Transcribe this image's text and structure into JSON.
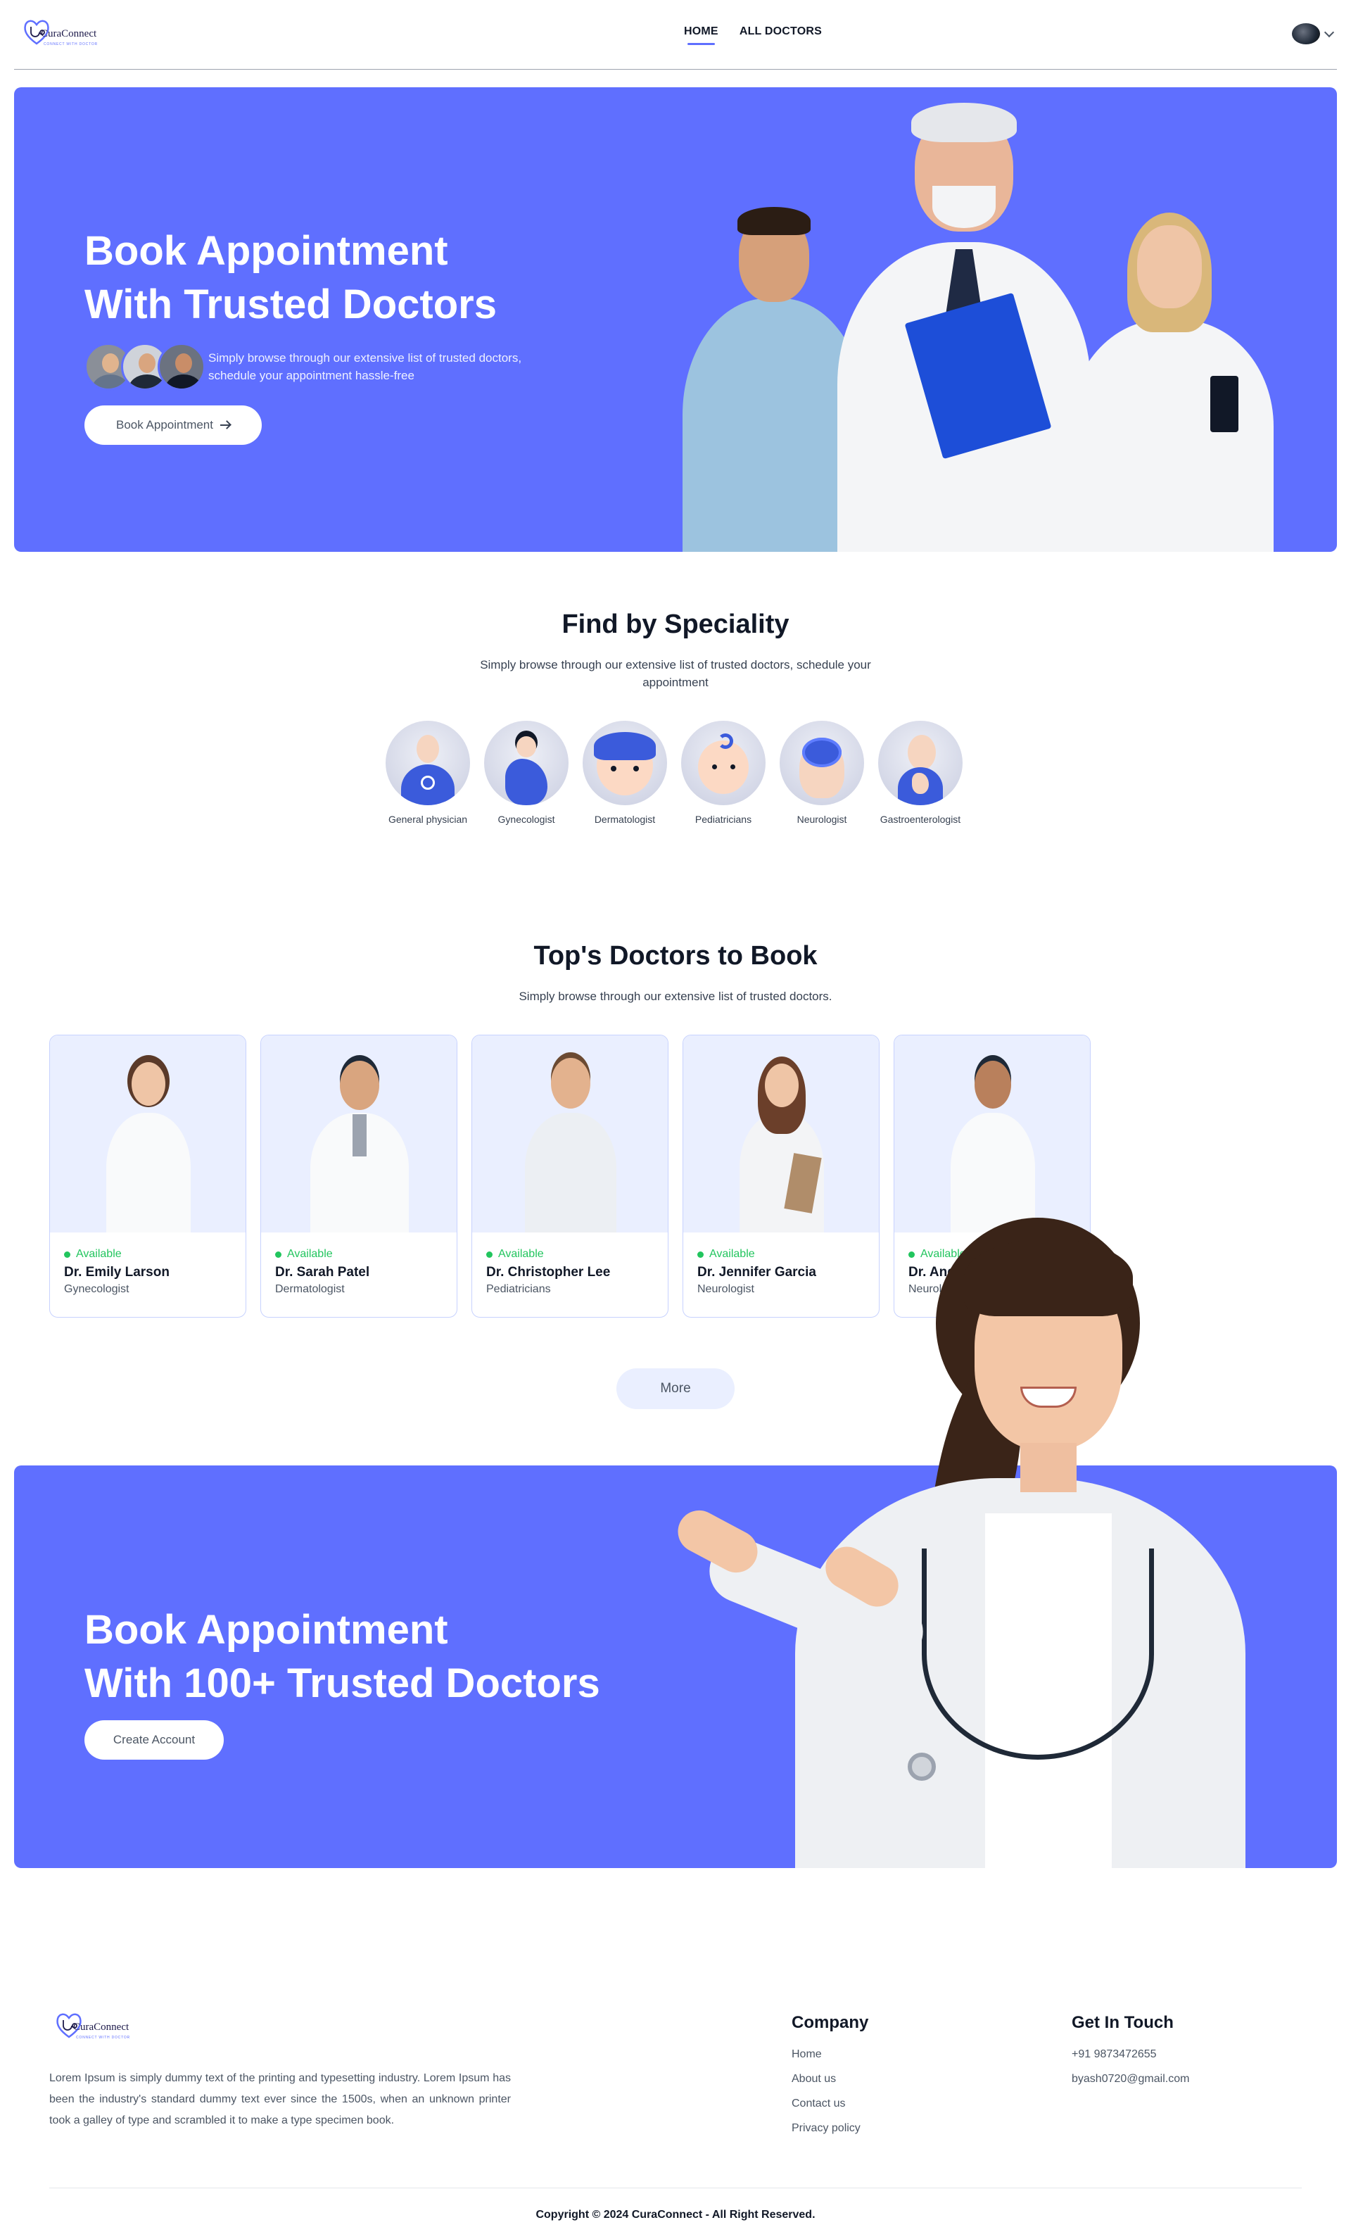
{
  "brand": {
    "name": "CuraConnect",
    "tagline": "CONNECT WITH DOCTOR",
    "accent": "#5f6fff"
  },
  "nav": {
    "links": [
      "HOME",
      "ALL DOCTORS"
    ],
    "active": "HOME"
  },
  "hero": {
    "title_line1": "Book Appointment",
    "title_line2": "With Trusted Doctors",
    "subtitle": "Simply browse through our extensive list of trusted doctors, schedule your appointment hassle-free",
    "button": "Book Appointment"
  },
  "speciality": {
    "title": "Find by Speciality",
    "subtitle": "Simply browse through our extensive list of trusted doctors, schedule your appointment",
    "items": [
      {
        "label": "General physician",
        "icon": "general-physician-icon"
      },
      {
        "label": "Gynecologist",
        "icon": "gynecologist-icon"
      },
      {
        "label": "Dermatologist",
        "icon": "dermatologist-icon"
      },
      {
        "label": "Pediatricians",
        "icon": "pediatrician-icon"
      },
      {
        "label": "Neurologist",
        "icon": "neurologist-icon"
      },
      {
        "label": "Gastroenterologist",
        "icon": "gastroenterologist-icon"
      }
    ]
  },
  "top_doctors": {
    "title": "Top's Doctors to Book",
    "subtitle": "Simply browse through our extensive list of trusted doctors.",
    "doctors": [
      {
        "status": "Available",
        "name": "Dr. Emily Larson",
        "speciality": "Gynecologist"
      },
      {
        "status": "Available",
        "name": "Dr. Sarah Patel",
        "speciality": "Dermatologist"
      },
      {
        "status": "Available",
        "name": "Dr. Christopher Lee",
        "speciality": "Pediatricians"
      },
      {
        "status": "Available",
        "name": "Dr. Jennifer Garcia",
        "speciality": "Neurologist"
      },
      {
        "status": "Available",
        "name": "Dr. Andrew Williams",
        "speciality": "Neurologist"
      }
    ],
    "more_button": "More"
  },
  "banner": {
    "title_line1": "Book Appointment",
    "title_line2": "With 100+ Trusted Doctors",
    "button": "Create Account"
  },
  "footer": {
    "about": "Lorem Ipsum is simply dummy text of the printing and typesetting industry. Lorem Ipsum has been the industry's standard dummy text ever since the 1500s, when an unknown printer took a galley of type and scrambled it to make a type specimen book.",
    "company": {
      "title": "Company",
      "links": [
        "Home",
        "About us",
        "Contact us",
        "Privacy policy"
      ]
    },
    "contact": {
      "title": "Get In Touch",
      "phone": "+91 9873472655",
      "email": "byash0720@gmail.com"
    },
    "copyright": "Copyright © 2024 CuraConnect - All Right Reserved."
  }
}
